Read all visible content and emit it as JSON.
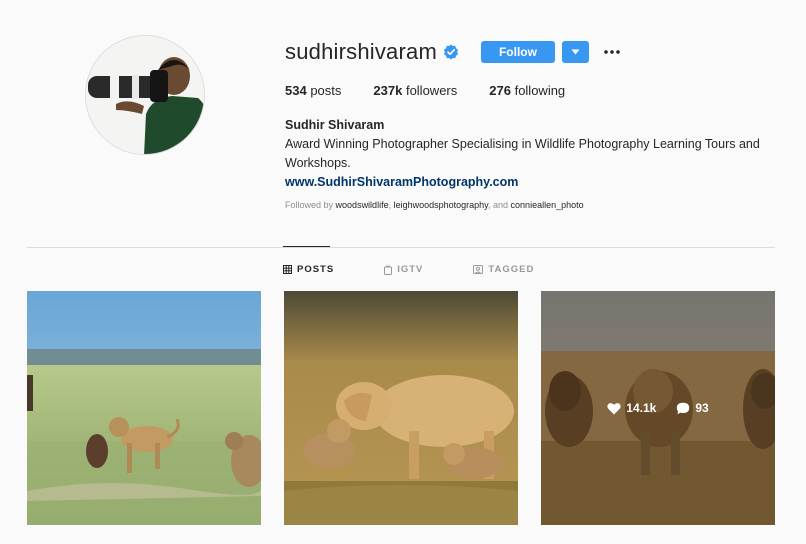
{
  "profile": {
    "username": "sudhirshivaram",
    "verified": true,
    "follow_label": "Follow"
  },
  "stats": {
    "posts_count": "534",
    "posts_label": "posts",
    "followers_count": "237k",
    "followers_label": "followers",
    "following_count": "276",
    "following_label": "following"
  },
  "bio": {
    "full_name": "Sudhir Shivaram",
    "description": "Award Winning Photographer Specialising in Wildlife Photography Learning Tours and Workshops.",
    "website": "www.SudhirShivaramPhotography.com",
    "followed_by_prefix": "Followed by",
    "followed_by_1": "woodswildlife",
    "followed_by_2": "leighwoodsphotography",
    "followed_by_and": ", and",
    "followed_by_3": "connieallen_photo"
  },
  "tabs": [
    {
      "label": "POSTS",
      "icon": "grid-icon",
      "active": true
    },
    {
      "label": "IGTV",
      "icon": "igtv-icon",
      "active": false
    },
    {
      "label": "TAGGED",
      "icon": "tagged-icon",
      "active": false
    }
  ],
  "posts": [
    {
      "subject": "lions chasing on plain"
    },
    {
      "subject": "lioness with cubs"
    },
    {
      "subject": "pride of lions",
      "likes": "14.1k",
      "comments": "93"
    }
  ],
  "colors": {
    "accent": "#3897f0",
    "link": "#003569",
    "muted": "#8e8e8e"
  }
}
